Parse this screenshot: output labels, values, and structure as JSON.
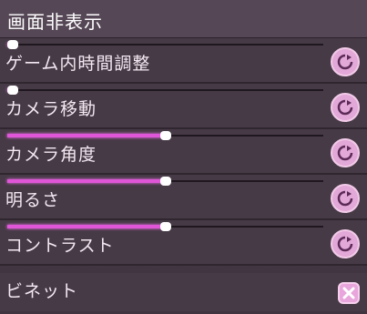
{
  "header": {
    "title": "画面非表示"
  },
  "rows": [
    {
      "label": "ゲーム内時間調整",
      "value": 0.01
    },
    {
      "label": "カメラ移動",
      "value": 0.01
    },
    {
      "label": "カメラ角度",
      "value": 0.5
    },
    {
      "label": "明るさ",
      "value": 0.5
    },
    {
      "label": "コントラスト",
      "value": 0.5
    }
  ],
  "vignette": {
    "label": "ビネット"
  },
  "colors": {
    "accent": "#e056d9",
    "button": "#e2a8d8",
    "toggle": "#e8a6dc"
  },
  "icons": {
    "reset": "reset-icon",
    "toggle": "close-icon"
  }
}
